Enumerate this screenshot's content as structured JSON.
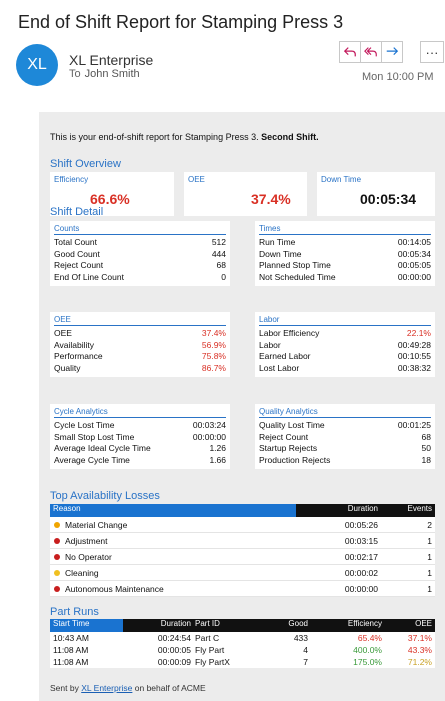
{
  "subject": "End of Shift Report for Stamping Press 3",
  "sender": {
    "initials": "XL",
    "name": "XL Enterprise",
    "to_label": "To",
    "to_name": "John Smith"
  },
  "date": "Mon 10:00 PM",
  "actions": {
    "more": "···"
  },
  "intro": {
    "text": "This is your end-of-shift report for Stamping Press 3.",
    "shift": "Second Shift."
  },
  "shift_overview": {
    "title": "Shift Overview",
    "efficiency": {
      "label": "Efficiency",
      "value": "66.6%"
    },
    "oee": {
      "label": "OEE",
      "value": "37.4%"
    },
    "downtime": {
      "label": "Down Time",
      "value": "00:05:34"
    }
  },
  "shift_detail": {
    "title": "Shift Detail",
    "counts": {
      "title": "Counts",
      "rows": [
        {
          "label": "Total Count",
          "value": "512"
        },
        {
          "label": "Good Count",
          "value": "444"
        },
        {
          "label": "Reject Count",
          "value": "68"
        },
        {
          "label": "End Of Line Count",
          "value": "0"
        }
      ]
    },
    "times": {
      "title": "Times",
      "rows": [
        {
          "label": "Run Time",
          "value": "00:14:05"
        },
        {
          "label": "Down Time",
          "value": "00:05:34"
        },
        {
          "label": "Planned Stop Time",
          "value": "00:05:05"
        },
        {
          "label": "Not Scheduled Time",
          "value": "00:00:00"
        }
      ]
    },
    "oee": {
      "title": "OEE",
      "rows": [
        {
          "label": "OEE",
          "value": "37.4%"
        },
        {
          "label": "Availability",
          "value": "56.9%"
        },
        {
          "label": "Performance",
          "value": "75.8%"
        },
        {
          "label": "Quality",
          "value": "86.7%"
        }
      ]
    },
    "labor": {
      "title": "Labor",
      "rows": [
        {
          "label": "Labor Efficiency",
          "value": "22.1%"
        },
        {
          "label": "Labor",
          "value": "00:49:28"
        },
        {
          "label": "Earned Labor",
          "value": "00:10:55"
        },
        {
          "label": "Lost Labor",
          "value": "00:38:32"
        }
      ]
    },
    "cycle": {
      "title": "Cycle Analytics",
      "rows": [
        {
          "label": "Cycle Lost Time",
          "value": "00:03:24"
        },
        {
          "label": "Small Stop Lost Time",
          "value": "00:00:00"
        },
        {
          "label": "Average Ideal Cycle Time",
          "value": "1.26"
        },
        {
          "label": "Average Cycle Time",
          "value": "1.66"
        }
      ]
    },
    "quality": {
      "title": "Quality Analytics",
      "rows": [
        {
          "label": "Quality Lost Time",
          "value": "00:01:25"
        },
        {
          "label": "Reject Count",
          "value": "68"
        },
        {
          "label": "Startup Rejects",
          "value": "50"
        },
        {
          "label": "Production Rejects",
          "value": "18"
        }
      ]
    }
  },
  "availability_losses": {
    "title": "Top Availability Losses",
    "columns": [
      "Reason",
      "Duration",
      "Events"
    ],
    "rows": [
      {
        "reason": "Material Change",
        "duration": "00:05:26",
        "events": "2",
        "dot": "#f0a500"
      },
      {
        "reason": "Adjustment",
        "duration": "00:03:15",
        "events": "1",
        "dot": "#c81e1e"
      },
      {
        "reason": "No Operator",
        "duration": "00:02:17",
        "events": "1",
        "dot": "#c81e1e"
      },
      {
        "reason": "Cleaning",
        "duration": "00:00:02",
        "events": "1",
        "dot": "#f0c020"
      },
      {
        "reason": "Autonomous Maintenance",
        "duration": "00:00:00",
        "events": "1",
        "dot": "#c81e1e"
      }
    ]
  },
  "part_runs": {
    "title": "Part Runs",
    "columns": [
      "Start Time",
      "Duration",
      "Part ID",
      "Good",
      "Efficiency",
      "OEE"
    ],
    "rows": [
      {
        "start": "10:43 AM",
        "duration": "00:24:54",
        "part": "Part C",
        "good": "433",
        "eff": "65.4%",
        "oee": "37.1%"
      },
      {
        "start": "11:08 AM",
        "duration": "00:00:05",
        "part": "Fly Part",
        "good": "4",
        "eff": "400.0%",
        "oee": "43.3%"
      },
      {
        "start": "11:08 AM",
        "duration": "00:00:09",
        "part": "Fly PartX",
        "good": "7",
        "eff": "175.0%",
        "oee": "71.2%"
      }
    ]
  },
  "footer": {
    "prefix": "Sent by",
    "link": "XL Enterprise",
    "suffix": "on behalf of ACME"
  },
  "colors": {
    "accent": "#2a73c6",
    "avatar": "#1e88d8",
    "header_blue": "#1a73d0",
    "header_black": "#111111",
    "bad": "#d93025",
    "good": "#3a9a3a",
    "warn": "#c9a227"
  }
}
